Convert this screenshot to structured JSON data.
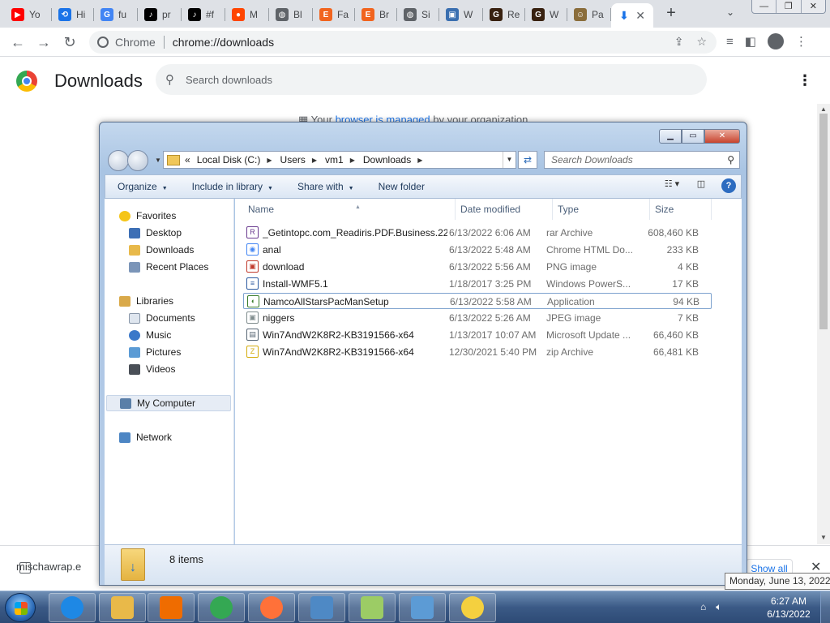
{
  "browser": {
    "tabs": [
      {
        "label": "Yo",
        "icon": "youtube-icon",
        "color": "#ff0000",
        "glyph": "▶"
      },
      {
        "label": "Hi",
        "icon": "history-icon",
        "color": "#1a73e8",
        "glyph": "⟲"
      },
      {
        "label": "fu",
        "icon": "google-icon",
        "color": "#4285f4",
        "glyph": "G"
      },
      {
        "label": "pr",
        "icon": "tiktok-icon",
        "color": "#000000",
        "glyph": "♪"
      },
      {
        "label": "#f",
        "icon": "tiktok-icon",
        "color": "#000000",
        "glyph": "♪"
      },
      {
        "label": "M",
        "icon": "reddit-icon",
        "color": "#ff4500",
        "glyph": "●"
      },
      {
        "label": "Bl",
        "icon": "globe-icon",
        "color": "#5f6368",
        "glyph": "◍"
      },
      {
        "label": "Fa",
        "icon": "etsy-icon",
        "color": "#f1641e",
        "glyph": "E"
      },
      {
        "label": "Br",
        "icon": "etsy-icon",
        "color": "#f1641e",
        "glyph": "E"
      },
      {
        "label": "Si",
        "icon": "globe-icon",
        "color": "#5f6368",
        "glyph": "◍"
      },
      {
        "label": "W",
        "icon": "image-icon",
        "color": "#3a6fb0",
        "glyph": "▣"
      },
      {
        "label": "Re",
        "icon": "goodreads-icon",
        "color": "#382110",
        "glyph": "G"
      },
      {
        "label": "W",
        "icon": "goodreads-icon",
        "color": "#382110",
        "glyph": "G"
      },
      {
        "label": "Pa",
        "icon": "people-icon",
        "color": "#8a6d3b",
        "glyph": "☺"
      }
    ],
    "active_tab_icon": "download-icon",
    "omnibox_chip": "Chrome",
    "url": "chrome://downloads",
    "window_buttons": [
      "—",
      "❐",
      "✕"
    ]
  },
  "downloads_page": {
    "title": "Downloads",
    "search_placeholder": "Search downloads",
    "managed_prefix": "Your ",
    "managed_link": "browser is managed",
    "managed_suffix": " by your organization",
    "shelf_file": "mischawrap.e",
    "show_all": "Show all"
  },
  "explorer": {
    "breadcrumb": [
      "Local Disk (C:)",
      "Users",
      "vm1",
      "Downloads"
    ],
    "search_placeholder": "Search Downloads",
    "commands": [
      {
        "label": "Organize",
        "dropdown": true
      },
      {
        "label": "Include in library",
        "dropdown": true
      },
      {
        "label": "Share with",
        "dropdown": true
      },
      {
        "label": "New folder",
        "dropdown": false
      }
    ],
    "columns": [
      "Name",
      "Date modified",
      "Type",
      "Size"
    ],
    "nav": {
      "favorites": "Favorites",
      "desktop": "Desktop",
      "downloads": "Downloads",
      "recent": "Recent Places",
      "libraries": "Libraries",
      "documents": "Documents",
      "music": "Music",
      "pictures": "Pictures",
      "videos": "Videos",
      "computer": "My Computer",
      "network": "Network"
    },
    "files": [
      {
        "name": "_Getintopc.com_Readiris.PDF.Business.22...",
        "date": "6/13/2022 6:06 AM",
        "type": "rar Archive",
        "size": "608,460 KB",
        "icon_color": "#6a3b8f",
        "glyph": "R"
      },
      {
        "name": "anal",
        "date": "6/13/2022 5:48 AM",
        "type": "Chrome HTML Do...",
        "size": "233 KB",
        "icon_color": "#4285f4",
        "glyph": "◉"
      },
      {
        "name": "download",
        "date": "6/13/2022 5:56 AM",
        "type": "PNG image",
        "size": "4 KB",
        "icon_color": "#c0392b",
        "glyph": "▣"
      },
      {
        "name": "Install-WMF5.1",
        "date": "1/18/2017 3:25 PM",
        "type": "Windows PowerS...",
        "size": "17 KB",
        "icon_color": "#2c5aa0",
        "glyph": "≡"
      },
      {
        "name": "NamcoAllStarsPacManSetup",
        "date": "6/13/2022 5:58 AM",
        "type": "Application",
        "size": "94 KB",
        "icon_color": "#3a7d2c",
        "glyph": "◐"
      },
      {
        "name": "niggers",
        "date": "6/13/2022 5:26 AM",
        "type": "JPEG image",
        "size": "7 KB",
        "icon_color": "#7f8c8d",
        "glyph": "▣"
      },
      {
        "name": "Win7AndW2K8R2-KB3191566-x64",
        "date": "1/13/2017 10:07 AM",
        "type": "Microsoft Update ...",
        "size": "66,460 KB",
        "icon_color": "#566573",
        "glyph": "▤"
      },
      {
        "name": "Win7AndW2K8R2-KB3191566-x64",
        "date": "12/30/2021 5:40 PM",
        "type": "zip Archive",
        "size": "66,481 KB",
        "icon_color": "#d4ac0d",
        "glyph": "Z"
      }
    ],
    "selected_file_index": 4,
    "item_count": "8 items"
  },
  "taskbar": {
    "apps": [
      {
        "name": "internet-explorer-icon",
        "color": "#1e88e5"
      },
      {
        "name": "windows-explorer-icon",
        "color": "#e9b949"
      },
      {
        "name": "media-player-icon",
        "color": "#ef6c00"
      },
      {
        "name": "chrome-icon",
        "color": "#34a853"
      },
      {
        "name": "firefox-icon",
        "color": "#ff7139"
      },
      {
        "name": "image-viewer-icon",
        "color": "#4e89c5"
      },
      {
        "name": "notepad-chart-icon",
        "color": "#9ccc65"
      },
      {
        "name": "control-panel-icon",
        "color": "#5c9bd5"
      },
      {
        "name": "d-app-icon",
        "color": "#f4d03f"
      }
    ],
    "time": "6:27 AM",
    "date": "6/13/2022",
    "tooltip": "Monday, June 13, 2022"
  }
}
